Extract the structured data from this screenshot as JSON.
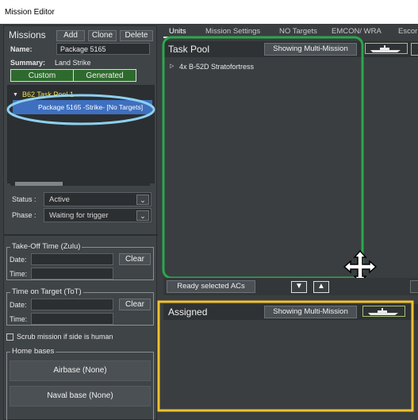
{
  "window": {
    "title": "Mission Editor"
  },
  "missions": {
    "heading": "Missions",
    "add_label": "Add",
    "clone_label": "Clone",
    "delete_label": "Delete",
    "name_label": "Name:",
    "name_value": "Package 5165",
    "summary_label": "Summary:",
    "summary_value": "Land Strike",
    "custom_label": "Custom",
    "generated_label": "Generated",
    "tree": {
      "pool_label": "B62 Task Pool 1",
      "item_label": "Package 5165  -Strike- [No Targets]"
    },
    "status_label": "Status :",
    "status_value": "Active",
    "phase_label": "Phase :",
    "phase_value": "Waiting for trigger"
  },
  "takeoff": {
    "legend": "Take-Off Time (Zulu)",
    "date_label": "Date:",
    "time_label": "Time:",
    "clear_label": "Clear"
  },
  "tot": {
    "legend": "Time on Target (ToT)",
    "date_label": "Date:",
    "time_label": "Time:",
    "clear_label": "Clear"
  },
  "scrub": {
    "label": "Scrub mission if side is human",
    "checked": false
  },
  "home_bases": {
    "legend": "Home bases",
    "airbase_label": "Airbase (None)",
    "naval_label": "Naval base (None)"
  },
  "tabs": [
    {
      "label": "Units",
      "active": true
    },
    {
      "label": "Mission Settings",
      "active": false
    },
    {
      "label": "NO Targets",
      "active": false
    },
    {
      "label": "EMCON/ WRA",
      "active": false
    },
    {
      "label": "Escor",
      "active": false
    }
  ],
  "task_pool": {
    "title": "Task Pool",
    "multi_label": "Showing Multi-Mission",
    "unit_label": "4x B-52D Stratofortress",
    "ready_label": "Ready selected ACs",
    "down_icon": "chevron-down-icon",
    "up_icon": "chevron-up-icon"
  },
  "assigned": {
    "title": "Assigned",
    "multi_label": "Showing Multi-Mission"
  },
  "colors": {
    "green_highlight": "#2aa84a",
    "yellow_highlight": "#f2c12e",
    "blue_highlight": "#8fd0ef",
    "selected_row": "#3f6fbf",
    "tree_pool_text": "#f3e04a"
  }
}
